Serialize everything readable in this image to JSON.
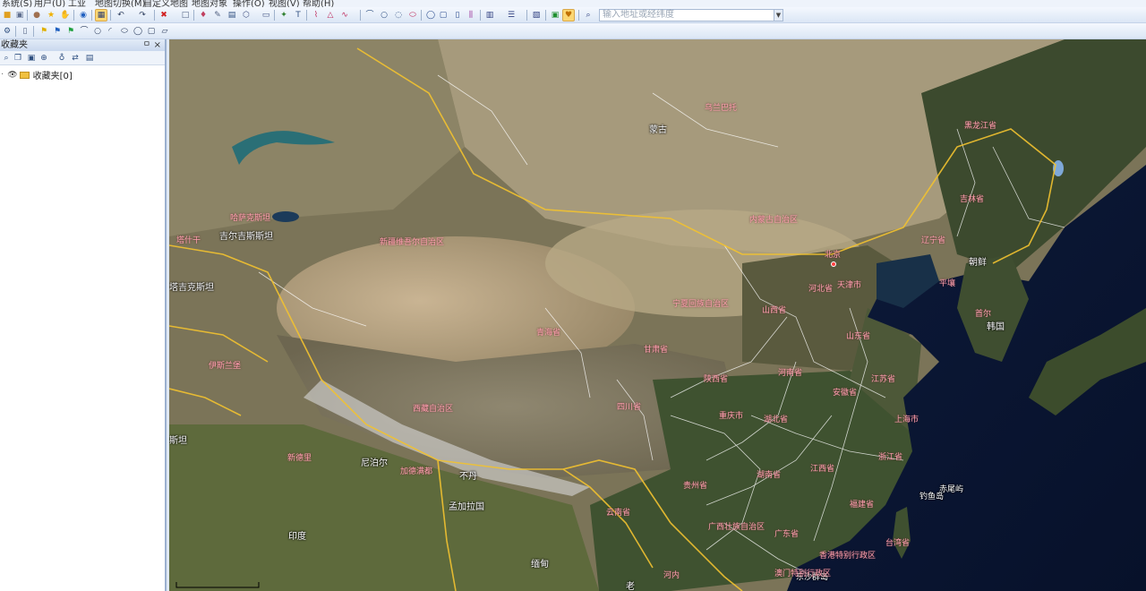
{
  "menu": [
    "系统(S)",
    "用户(U)",
    "工业",
    "地图切换(M)",
    "自定义地图",
    "地图对象",
    "操作(O)",
    "视图(V)",
    "帮助(H)"
  ],
  "toolbar1": {
    "icons": [
      "open-icon",
      "save-icon",
      "user-icon",
      "star-icon",
      "hand-icon",
      "globe-icon",
      "grid-icon",
      "undo-icon",
      "redo-icon",
      "delete-icon",
      "rect-icon",
      "marker-icon",
      "pencil-icon",
      "print-icon",
      "hexagon-icon",
      "camera-icon",
      "pin-icon",
      "text-icon",
      "polyline-icon",
      "triangle-icon",
      "curve-icon",
      "circle-icon",
      "ring-icon",
      "arc-icon",
      "ellipse-icon",
      "circle2-icon",
      "square-icon",
      "doc-icon",
      "columns-icon",
      "layout-icon",
      "list-icon",
      "layers-icon",
      "chat-icon",
      "badge-icon",
      "search-icon"
    ],
    "address_placeholder": "输入地址或经纬度"
  },
  "toolbar2": {
    "icons": [
      "gear-icon",
      "page-icon",
      "flag-yellow-icon",
      "flag-blue-icon",
      "flag-green-icon",
      "line-icon",
      "circle-outline-icon",
      "arc-left-icon",
      "arc-right-icon",
      "ellipse2-icon",
      "ring2-icon",
      "square2-icon",
      "doc2-icon"
    ]
  },
  "panel": {
    "title": "收藏夹",
    "pin": "ㅁ",
    "close": "×",
    "tree_root": "收藏夹[0]"
  },
  "map": {
    "labels_white": [
      {
        "t": "蒙古",
        "cls": "big"
      },
      {
        "t": "吉尔吉斯斯坦",
        "cls": "big"
      },
      {
        "t": "塔吉克斯坦",
        "cls": "big"
      },
      {
        "t": "尼泊尔",
        "cls": "big"
      },
      {
        "t": "不丹",
        "cls": "big"
      },
      {
        "t": "朝鲜",
        "cls": "big"
      },
      {
        "t": "韩国",
        "cls": "big"
      },
      {
        "t": "印度",
        "cls": "big"
      },
      {
        "t": "孟加拉国",
        "cls": "big"
      },
      {
        "t": "缅甸",
        "cls": "big"
      },
      {
        "t": "斯坦",
        "cls": "big"
      },
      {
        "t": "老",
        "cls": "big"
      },
      {
        "t": "赤尾屿",
        "cls": ""
      },
      {
        "t": "钓鱼岛",
        "cls": ""
      },
      {
        "t": "东沙群岛",
        "cls": ""
      }
    ],
    "labels_pink": [
      "乌兰巴托",
      "黑龙江省",
      "吉林省",
      "辽宁省",
      "内蒙古自治区",
      "北京",
      "天津市",
      "河北省",
      "平壤",
      "首尔",
      "山西省",
      "山东省",
      "新疆维吾尔自治区",
      "哈萨克斯坦",
      "塔什干",
      "宁夏回族自治区",
      "青海省",
      "甘肃省",
      "陕西省",
      "河南省",
      "江苏省",
      "安徽省",
      "上海市",
      "西藏自治区",
      "四川省",
      "重庆市",
      "湖北省",
      "浙江省",
      "新德里",
      "加德满都",
      "伊斯兰堡",
      "贵州省",
      "湖南省",
      "江西省",
      "福建省",
      "云南省",
      "广西壮族自治区",
      "广东省",
      "台湾省",
      "香港特别行政区",
      "澳门特别行政区",
      "河内"
    ]
  }
}
